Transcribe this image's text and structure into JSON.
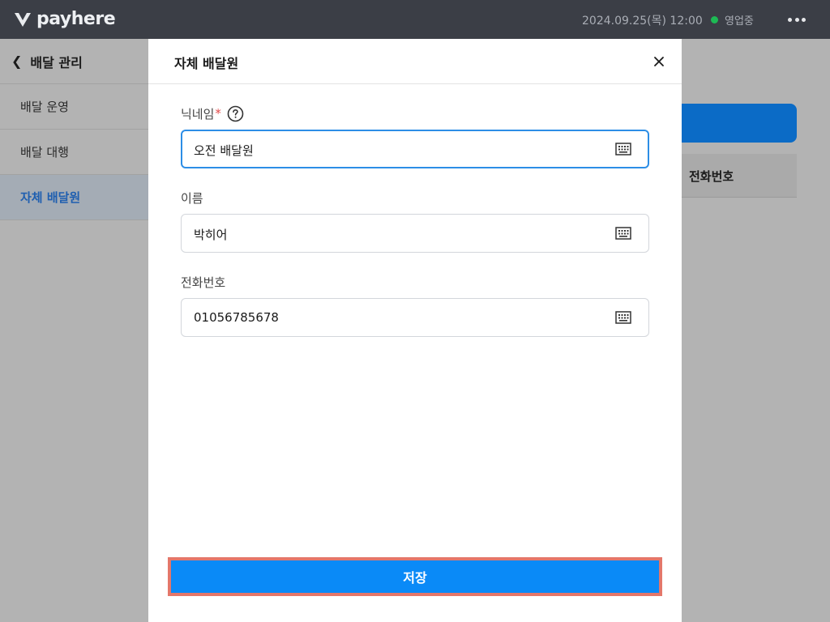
{
  "topbar": {
    "brand": "payhere",
    "datetime": "2024.09.25(목) 12:00",
    "status_text": "영업중",
    "status_color": "#1db954",
    "more_icon": "more-horizontal-icon"
  },
  "sidebar": {
    "back_label": "배달 관리",
    "items": [
      {
        "label": "배달 운영"
      },
      {
        "label": "배달 대행"
      },
      {
        "label": "자체 배달원",
        "active": true
      }
    ]
  },
  "background": {
    "column_header": "전화번호"
  },
  "modal": {
    "title": "자체 배달원",
    "fields": [
      {
        "label": "닉네임",
        "required_mark": "*",
        "value": "오전 배달원",
        "focused": true,
        "has_help": true
      },
      {
        "label": "이름",
        "value": "박히어"
      },
      {
        "label": "전화번호",
        "value": "01056785678"
      }
    ],
    "save_label": "저장",
    "accent_color": "#0a8af7"
  }
}
